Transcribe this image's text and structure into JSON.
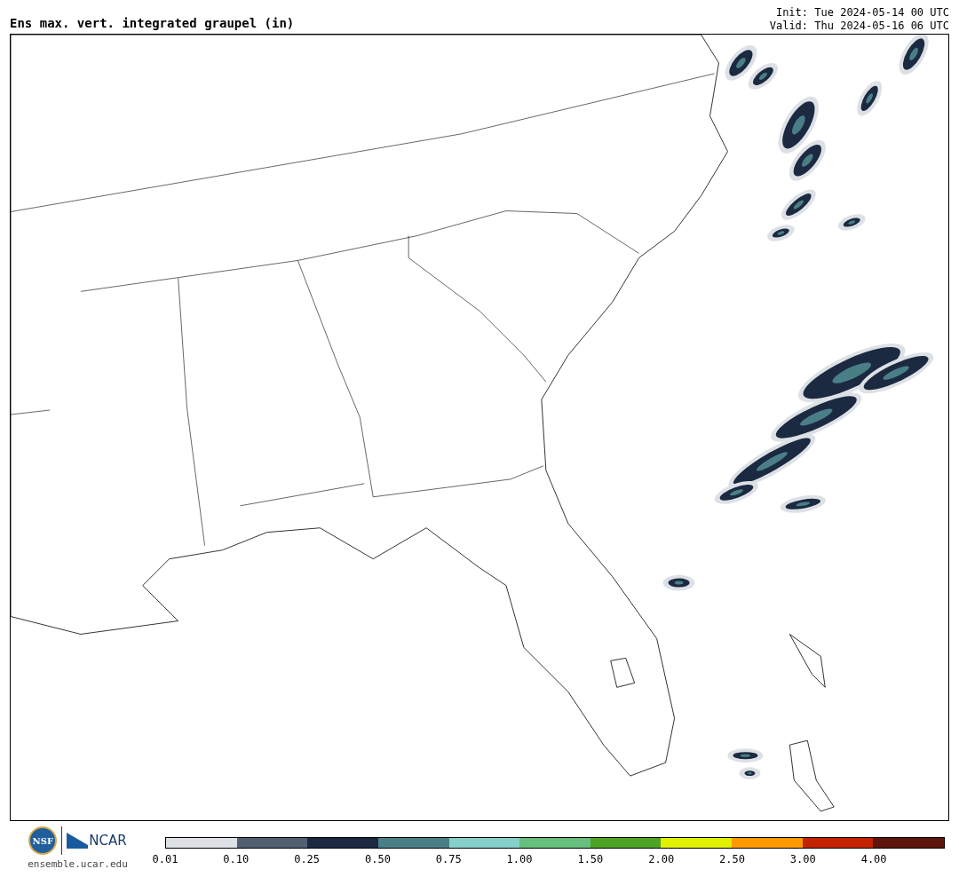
{
  "title": "Ens max. vert. integrated graupel (in)",
  "init": "Init: Tue 2024-05-14 00 UTC",
  "valid": "Valid: Thu 2024-05-16 06 UTC",
  "logos": {
    "nsf": "NSF",
    "ncar": "NCAR",
    "url": "ensemble.ucar.edu"
  },
  "legend": [
    {
      "label": "0.01",
      "color": "#dde1e6"
    },
    {
      "label": "0.10",
      "color": "#525e72"
    },
    {
      "label": "0.25",
      "color": "#1b2a40"
    },
    {
      "label": "0.50",
      "color": "#4a7e86"
    },
    {
      "label": "0.75",
      "color": "#86d0cc"
    },
    {
      "label": "1.00",
      "color": "#67bf7e"
    },
    {
      "label": "1.50",
      "color": "#4ea225"
    },
    {
      "label": "2.00",
      "color": "#e0f000"
    },
    {
      "label": "2.50",
      "color": "#fd9a00"
    },
    {
      "label": "3.00",
      "color": "#c42300"
    },
    {
      "label": "4.00",
      "color": "#5e150b"
    }
  ]
}
